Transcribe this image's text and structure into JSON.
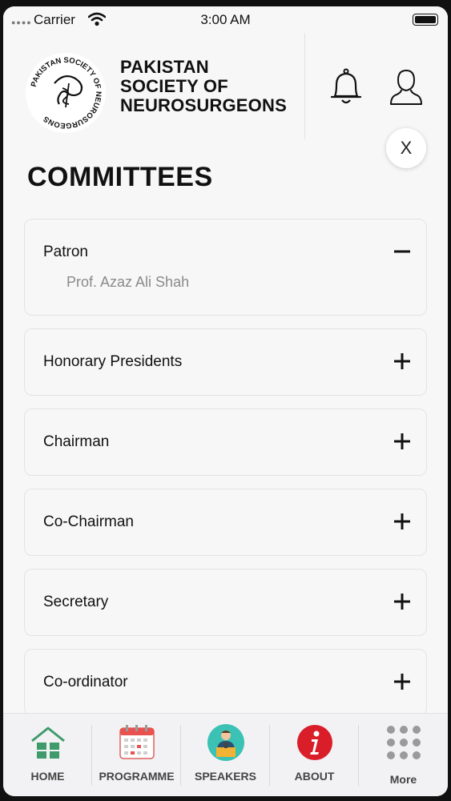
{
  "status_bar": {
    "carrier": "Carrier",
    "time": "3:00 AM"
  },
  "header": {
    "brand_line1": "PAKISTAN",
    "brand_line2": "SOCIETY OF",
    "brand_line3": "NEUROSURGEONS",
    "logo_ring_text": "PAKISTAN SOCIETY OF NEUROSURGEONS"
  },
  "close_label": "X",
  "page_title": "COMMITTEES",
  "committees": [
    {
      "title": "Patron",
      "expanded": true,
      "members": [
        "Prof. Azaz Ali Shah"
      ]
    },
    {
      "title": "Honorary Presidents",
      "expanded": false
    },
    {
      "title": "Chairman",
      "expanded": false
    },
    {
      "title": "Co-Chairman",
      "expanded": false
    },
    {
      "title": "Secretary",
      "expanded": false
    },
    {
      "title": "Co-ordinator",
      "expanded": false
    }
  ],
  "tabs": [
    {
      "label": "HOME",
      "icon": "home-icon"
    },
    {
      "label": "PROGRAMME",
      "icon": "calendar-icon"
    },
    {
      "label": "SPEAKERS",
      "icon": "speaker-icon"
    },
    {
      "label": "ABOUT",
      "icon": "info-icon"
    },
    {
      "label": "More",
      "icon": "grid-icon"
    }
  ],
  "colors": {
    "accent_red": "#d91e2a",
    "home_green": "#3f9b6c",
    "speaker_teal": "#3cc1b5"
  }
}
